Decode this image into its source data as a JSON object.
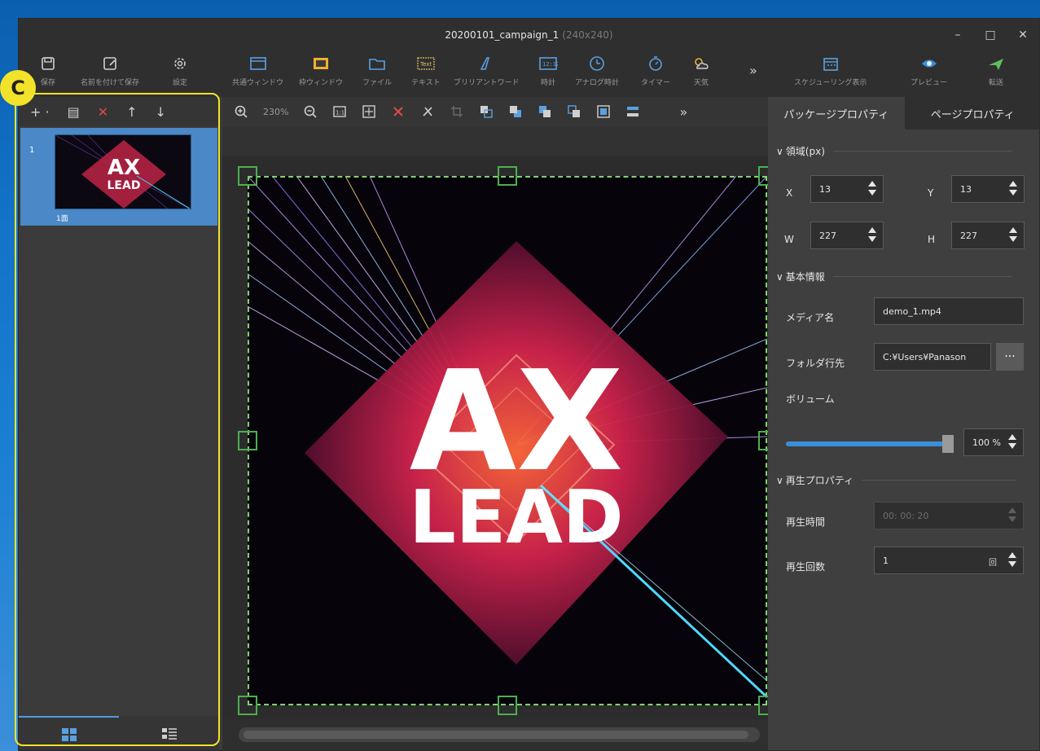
{
  "window": {
    "title": "20200101_campaign_1",
    "title_dim": "(240x240)",
    "controls": [
      "–",
      "□",
      "✕"
    ]
  },
  "ribbon": {
    "save": "保存",
    "save_as": "名前を付けて保存",
    "settings": "設定",
    "common_window": "共通ウィンドウ",
    "frame_window": "枠ウィンドウ",
    "file": "ファイル",
    "text": "テキスト",
    "brilliant_word": "ブリリアントワード",
    "clock": "時計",
    "analog_clock": "アナログ時計",
    "timer": "タイマー",
    "weather": "天気",
    "more": "»",
    "schedule": "スケジューリング表示",
    "preview": "プレビュー",
    "transfer": "転送"
  },
  "left_panel": {
    "tools": [
      "+ ·",
      "▤",
      "✕",
      "↑",
      "↓"
    ],
    "items": [
      {
        "num": "1",
        "label": "1面"
      }
    ]
  },
  "center": {
    "zoom": "230%",
    "more": "»"
  },
  "right_panel": {
    "tab_package": "パッケージプロパティ",
    "tab_page": "ページプロパティ",
    "section_area": "領域(px)",
    "x_label": "X",
    "x_value": "13",
    "y_label": "Y",
    "y_value": "13",
    "w_label": "W",
    "w_value": "227",
    "h_label": "H",
    "h_value": "227",
    "section_basic": "基本情報",
    "media_label": "メディア名",
    "media_value": "demo_1.mp4",
    "folder_label": "フォルダ行先",
    "folder_value": "C:¥Users¥Panason",
    "folder_more": "···",
    "volume_label": "ボリューム",
    "volume_value": "100 %",
    "volume_level": 1.0,
    "section_play": "再生プロパティ",
    "duration_label": "再生時間",
    "duration_value": "00: 00: 20",
    "count_label": "再生回数",
    "count_value": "1",
    "count_unit": "回"
  },
  "annotation": {
    "badge": "C"
  },
  "artwork": {
    "logo_top": "AX",
    "logo_bottom": "LEAD"
  }
}
